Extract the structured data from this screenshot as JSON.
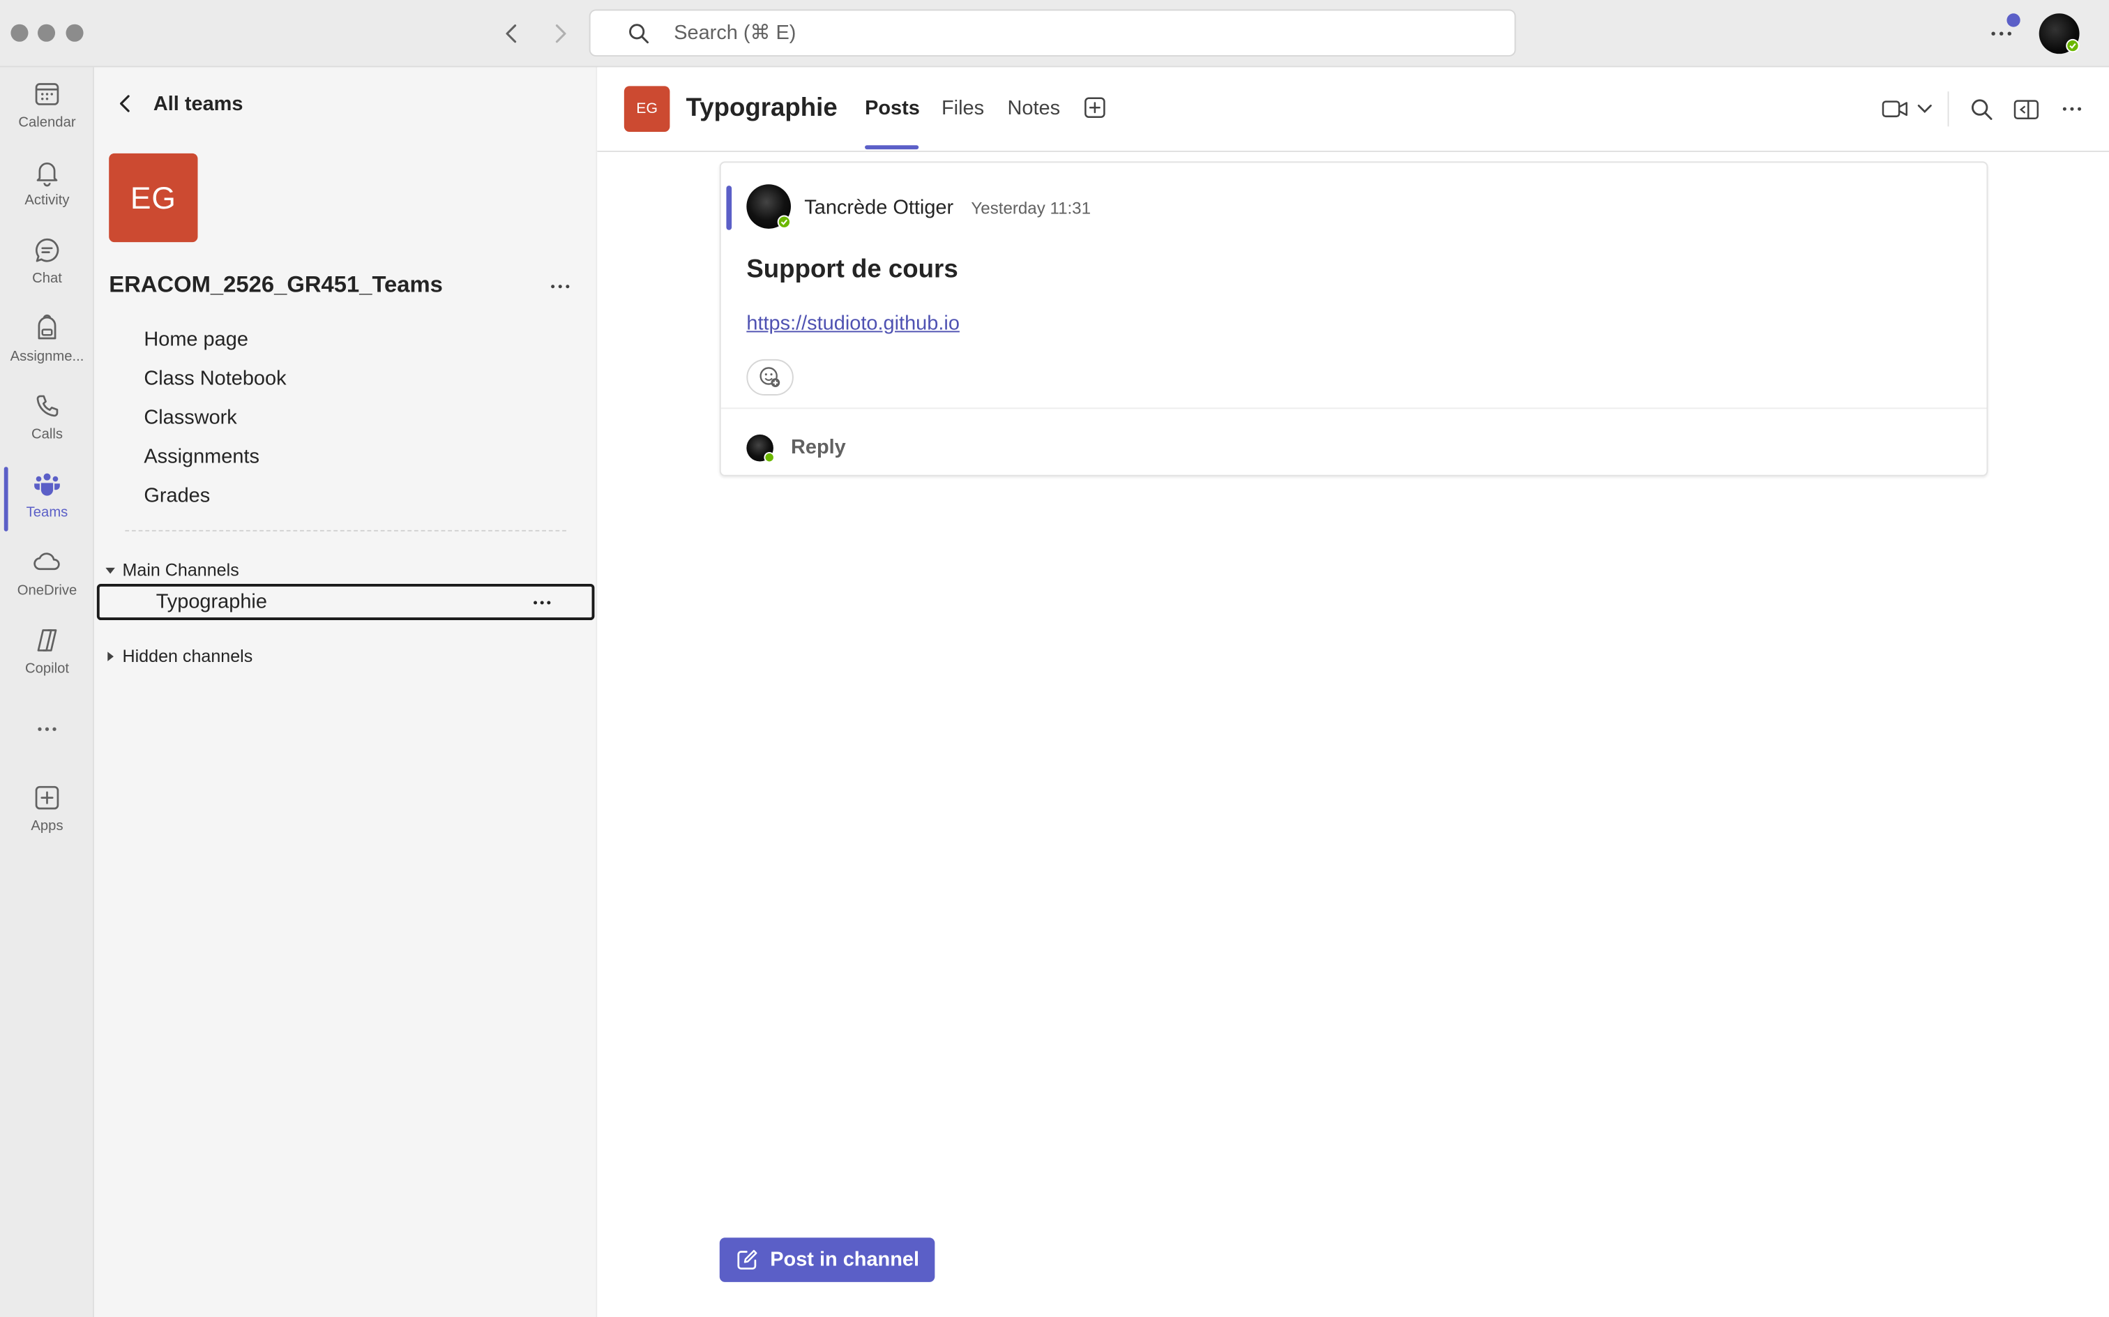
{
  "titlebar": {
    "search_placeholder": "Search (⌘ E)"
  },
  "rail": {
    "items": [
      {
        "label": "Calendar",
        "icon": "calendar-icon"
      },
      {
        "label": "Activity",
        "icon": "bell-icon"
      },
      {
        "label": "Chat",
        "icon": "chat-icon"
      },
      {
        "label": "Assignme...",
        "icon": "backpack-icon"
      },
      {
        "label": "Calls",
        "icon": "phone-icon"
      },
      {
        "label": "Teams",
        "icon": "teams-icon",
        "active": true
      },
      {
        "label": "OneDrive",
        "icon": "cloud-icon"
      },
      {
        "label": "Copilot",
        "icon": "copilot-icon"
      },
      {
        "label": "Apps",
        "icon": "plus-square-icon"
      }
    ]
  },
  "leftpane": {
    "back_label": "All teams",
    "team_initials": "EG",
    "team_name": "ERACOM_2526_GR451_Teams",
    "links": [
      "Home page",
      "Class Notebook",
      "Classwork",
      "Assignments",
      "Grades"
    ],
    "main_channels_label": "Main Channels",
    "selected_channel": "Typographie",
    "hidden_channels_label": "Hidden channels"
  },
  "header": {
    "tile_initials": "EG",
    "title": "Typographie",
    "tabs": [
      "Posts",
      "Files",
      "Notes"
    ],
    "active_tab": "Posts"
  },
  "post": {
    "author": "Tancrède Ottiger",
    "time": "Yesterday 11:31",
    "subject": "Support de cours",
    "link": "https://studioto.github.io",
    "reply_label": "Reply"
  },
  "compose": {
    "post_button_label": "Post in channel"
  },
  "colors": {
    "accent": "#5b5fc7",
    "team_tile": "#cc4a31",
    "presence_available": "#6bb700"
  }
}
